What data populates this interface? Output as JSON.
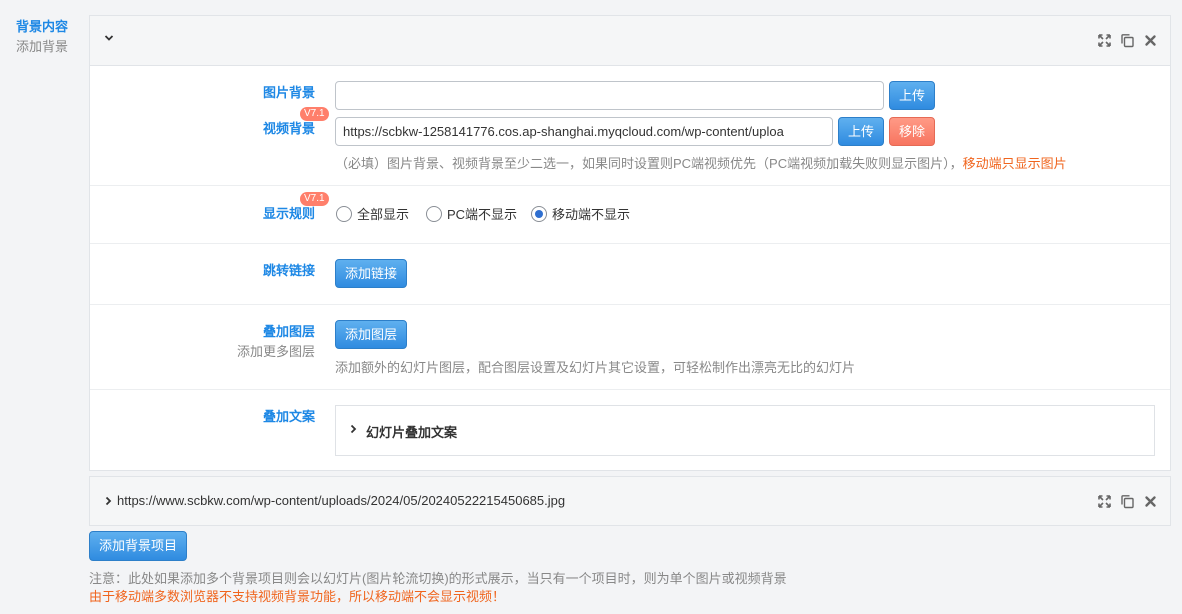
{
  "sidebar": {
    "title": "背景内容",
    "subtitle": "添加背景"
  },
  "colors": {
    "accent": "#1e88e5",
    "badge": "#ff7f6b",
    "warning": "#f0651e",
    "button": "#2f8be0",
    "remove_button": "#f77560"
  },
  "panel": {
    "header_icons": [
      "expand-icon",
      "copy-icon",
      "close-icon"
    ],
    "image_bg": {
      "label": "图片背景",
      "value": "",
      "upload_label": "上传"
    },
    "video_bg": {
      "label": "视频背景",
      "badge": "V7.1",
      "value": "https://scbkw-1258141776.cos.ap-shanghai.myqcloud.com/wp-content/uploa",
      "upload_label": "上传",
      "remove_label": "移除"
    },
    "bg_hint": "（必填）图片背景、视频背景至少二选一，如果同时设置则PC端视频优先（PC端视频加载失败则显示图片），",
    "bg_hint_warning": "移动端只显示图片",
    "display_rule": {
      "label": "显示规则",
      "badge": "V7.1",
      "options": [
        "全部显示",
        "PC端不显示",
        "移动端不显示"
      ],
      "selected": "移动端不显示"
    },
    "link": {
      "label": "跳转链接",
      "button_label": "添加链接"
    },
    "layer": {
      "label": "叠加图层",
      "sublabel": "添加更多图层",
      "button_label": "添加图层",
      "hint": "添加额外的幻灯片图层，配合图层设置及幻灯片其它设置，可轻松制作出漂亮无比的幻灯片"
    },
    "text": {
      "label": "叠加文案",
      "group_title": "幻灯片叠加文案"
    }
  },
  "panel2": {
    "title": "https://www.scbkw.com/wp-content/uploads/2024/05/20240522215450685.jpg"
  },
  "footer": {
    "add_button": "添加背景项目",
    "note": "注意：此处如果添加多个背景项目则会以幻灯片(图片轮流切换)的形式展示，当只有一个项目时，则为单个图片或视频背景",
    "warning": "由于移动端多数浏览器不支持视频背景功能，所以移动端不会显示视频！"
  }
}
